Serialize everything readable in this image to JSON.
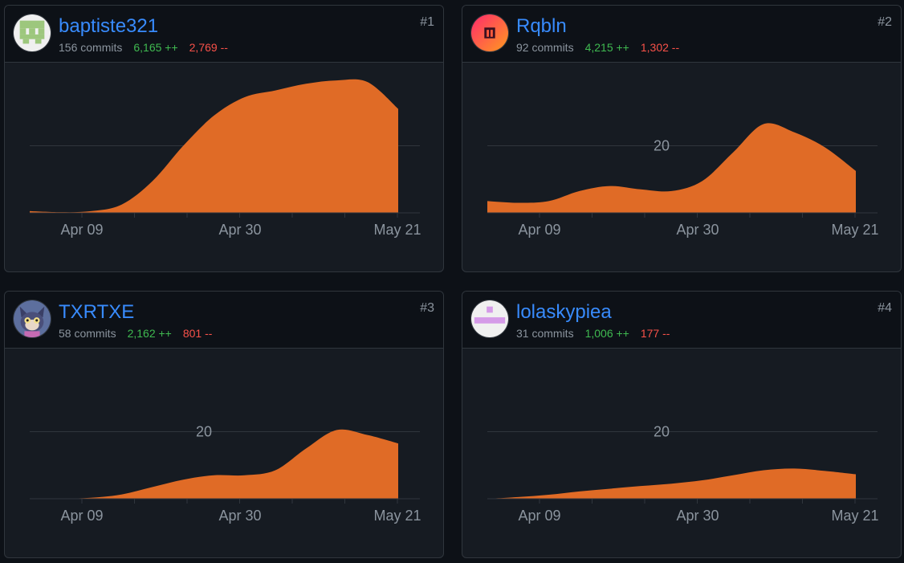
{
  "colors": {
    "area": "#e06b26",
    "grid": "#30363d",
    "link": "#388bfd",
    "additions": "#3fb950",
    "deletions": "#f85149",
    "muted": "#8b949e"
  },
  "x_axis": {
    "labels": [
      "Apr 09",
      "Apr 30",
      "May 21"
    ]
  },
  "contributors": [
    {
      "rank": "#1",
      "username": "baptiste321",
      "avatar": "green-pixel-identicon",
      "commits": "156 commits",
      "additions": "6,165 ++",
      "deletions": "2,769 --",
      "chart_data": {
        "type": "area",
        "ylim": [
          0,
          40
        ],
        "gridline_label": "",
        "values": [
          0.5,
          0.2,
          0.5,
          2.5,
          9.5,
          20,
          29,
          34.5,
          36.5,
          38.5,
          39.5,
          39,
          31
        ]
      }
    },
    {
      "rank": "#2",
      "username": "Rqbln",
      "avatar": "gradient-logo-icon",
      "commits": "92 commits",
      "additions": "4,215 ++",
      "deletions": "1,302 --",
      "chart_data": {
        "type": "area",
        "ylim": [
          0,
          40
        ],
        "gridline_label": "20",
        "values": [
          3.5,
          3,
          3.5,
          6.5,
          8,
          7,
          6.5,
          9.5,
          18,
          26.5,
          24,
          19.5,
          12.5
        ]
      }
    },
    {
      "rank": "#3",
      "username": "TXRTXE",
      "avatar": "cartoon-cat-avatar",
      "commits": "58 commits",
      "additions": "2,162 ++",
      "deletions": "801 --",
      "chart_data": {
        "type": "area",
        "ylim": [
          0,
          40
        ],
        "gridline_label": "20",
        "values": [
          0,
          0,
          0.3,
          1.3,
          3.5,
          5.7,
          7,
          7,
          8.5,
          15,
          20.5,
          19,
          16.5
        ]
      }
    },
    {
      "rank": "#4",
      "username": "lolaskypiea",
      "avatar": "pink-pixel-identicon",
      "commits": "31 commits",
      "additions": "1,006 ++",
      "deletions": "177 --",
      "chart_data": {
        "type": "area",
        "ylim": [
          0,
          40
        ],
        "gridline_label": "20",
        "values": [
          0,
          0.5,
          1.2,
          2.2,
          3,
          3.8,
          4.5,
          5.5,
          7,
          8.5,
          9,
          8.3,
          7.3
        ]
      }
    }
  ]
}
